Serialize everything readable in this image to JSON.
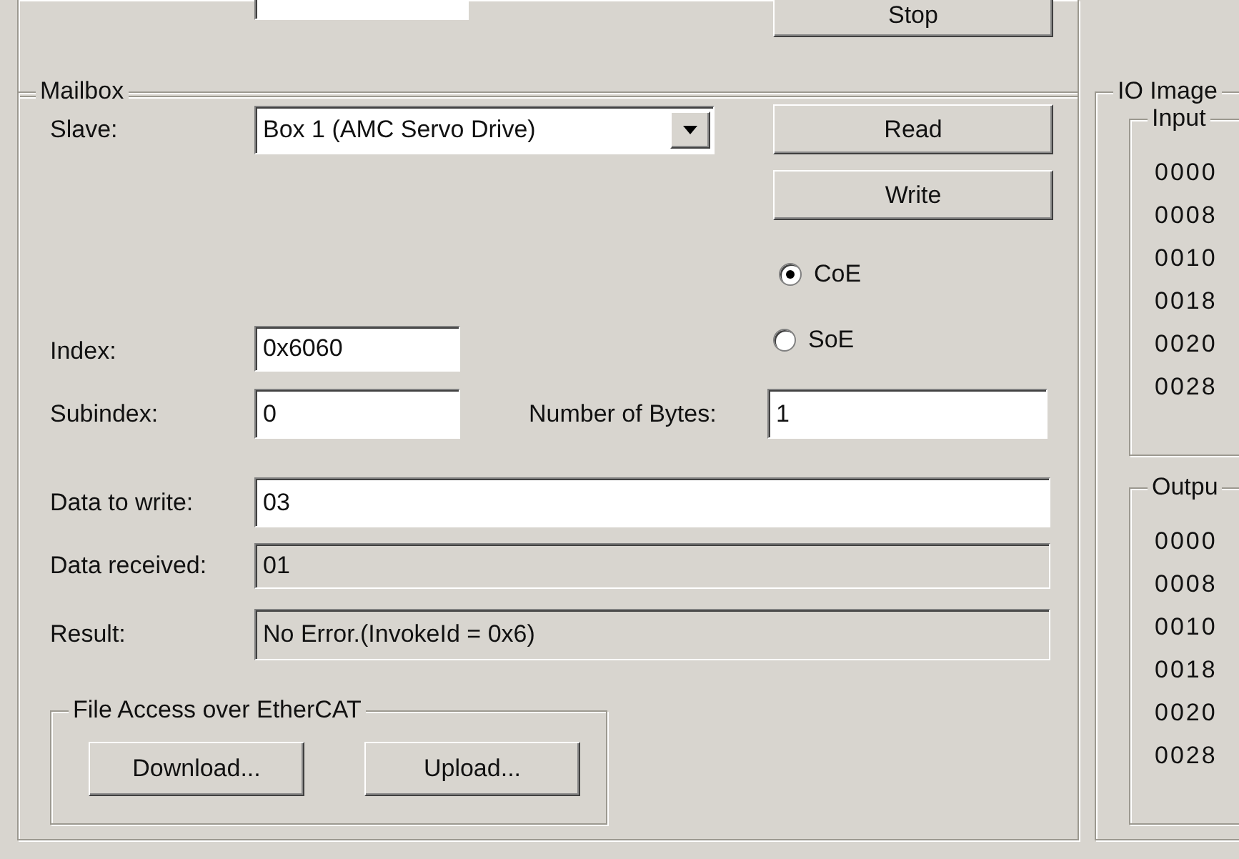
{
  "top": {
    "stop_button": "Stop"
  },
  "mailbox": {
    "title": "Mailbox",
    "slave": {
      "label": "Slave:",
      "value": "Box 1 (AMC Servo Drive)"
    },
    "read_button": "Read",
    "write_button": "Write",
    "protocols": [
      {
        "label": "CoE",
        "selected": true
      },
      {
        "label": "SoE",
        "selected": false
      }
    ],
    "index": {
      "label": "Index:",
      "value": "0x6060"
    },
    "subindex": {
      "label": "Subindex:",
      "value": "0"
    },
    "number_of_bytes": {
      "label": "Number of Bytes:",
      "value": "1"
    },
    "data_to_write": {
      "label": "Data to write:",
      "value": "03",
      "readonly": false
    },
    "data_received": {
      "label": "Data received:",
      "value": "01",
      "readonly": true
    },
    "result": {
      "label": "Result:",
      "value": "No Error.(InvokeId = 0x6)",
      "readonly": true
    },
    "file_access": {
      "title": "File Access over EtherCAT",
      "buttons": [
        "Download...",
        "Upload..."
      ]
    }
  },
  "io_image": {
    "title": "IO Image",
    "input": {
      "title": "Input",
      "rows": [
        "0000",
        "0008",
        "0010",
        "0018",
        "0020",
        "0028"
      ]
    },
    "output": {
      "title": "Outpu",
      "rows": [
        "0000",
        "0008",
        "0010",
        "0018",
        "0020",
        "0028"
      ]
    }
  }
}
